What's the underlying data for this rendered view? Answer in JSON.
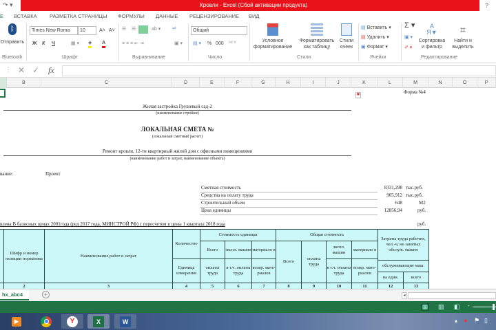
{
  "window": {
    "title": "Кровли -  Excel (Сбой активации продукта)",
    "help": "?"
  },
  "tabs": [
    "Е",
    "ВСТАВКА",
    "РАЗМЕТКА СТРАНИЦЫ",
    "ФОРМУЛЫ",
    "ДАННЫЕ",
    "РЕЦЕНЗИРОВАНИЕ",
    "ВИД"
  ],
  "ribbon": {
    "bluetooth": {
      "button": "Отправить",
      "group": "Bluetooth"
    },
    "font": {
      "name": "Times New Roma",
      "size": "10",
      "bold": "Ж",
      "italic": "К",
      "underline": "Ч",
      "group": "Шрифт"
    },
    "alignment": {
      "group": "Выравнивание"
    },
    "number": {
      "format": "Общий",
      "percent": "%",
      "thousands": "000",
      "group": "Число"
    },
    "styles": {
      "conditional": "Условное форматирование",
      "as_table": "Форматировать как таблицу",
      "cell_styles": "Стили ячеек",
      "group": "Стили"
    },
    "cells": {
      "insert": "Вставить",
      "delete": "Удалить",
      "format": "Формат",
      "group": "Ячейки"
    },
    "editing": {
      "sort": "Сортировка и фильтр",
      "find": "Найти и выделить",
      "group": "Редактирование"
    }
  },
  "formula_bar": {
    "fx": "fx",
    "value": ""
  },
  "columns": [
    "B",
    "C",
    "D",
    "E",
    "F",
    "G",
    "H",
    "I",
    "J",
    "K",
    "L",
    "M",
    "N",
    "O",
    "P"
  ],
  "sheet": {
    "form": "Форма №4",
    "construction": "Жилая застройка Грушевый сад-2",
    "construction_caption": "(наименование стройки)",
    "title": "ЛОКАЛЬНАЯ СМЕТА №",
    "title_caption": "(локальный сметный расчет)",
    "object": "Ремонт кровли, 12-ти квартирный жилой дом с офисными помещениями",
    "object_caption": "(наименование работ и затрат, наименование объекта)",
    "basis_label": "вание:",
    "basis_value": "Проект",
    "summary": [
      {
        "label": "Сметная стоимость",
        "value": "8331,298",
        "unit": "тыс.руб."
      },
      {
        "label": "Средства на оплату труда",
        "value": "905,912",
        "unit": "тыс.руб."
      },
      {
        "label": "Строительный объем",
        "value": "648",
        "unit": "М2"
      },
      {
        "label": "Цена единицы",
        "value": "12856,94",
        "unit": "руб."
      }
    ],
    "prices_note": "влена В базисных ценах 2001года (ред 2017 года, МИНСТРОЙ РФ) с пересчетом в цены 1 квартала 2018 года",
    "currency": "руб.",
    "table": {
      "code": "Шифр и номер позиции норматива",
      "name": "Наименование работ и затрат",
      "qty": "Количество",
      "unit": "Единица измерения",
      "unit_cost": "Стоимость единицы",
      "total_cost": "Общая стоимость",
      "all": "Всего",
      "machines": "экспл. машин",
      "materials": "материало в",
      "wages": "оплаты труда",
      "incl_wages": "в т.ч. оплаты труда",
      "returnable": "возвр. мате-риалов",
      "labor": "Затраты труда рабочих, чел.-ч, не занятых обслуж. машин",
      "servicing": "обслуживающие маш.",
      "per_unit": "на един.",
      "labor_total": "всего",
      "numbers": [
        "2",
        "3",
        "4",
        "5",
        "6",
        "7",
        "8",
        "9",
        "10",
        "11",
        "12",
        "13"
      ]
    }
  },
  "sheet_tabs": [
    "hx_abc4"
  ],
  "taskbar": [
    "media-player",
    "chrome",
    "yandex",
    "excel",
    "word"
  ]
}
